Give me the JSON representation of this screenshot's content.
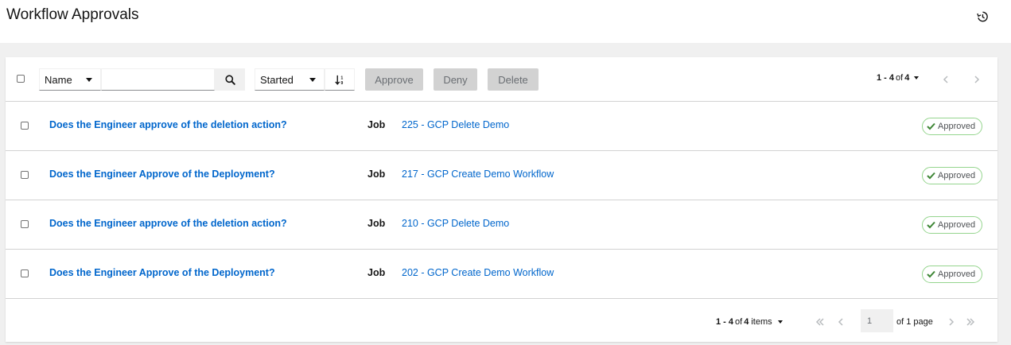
{
  "header": {
    "title": "Workflow Approvals",
    "history_icon": "history-icon"
  },
  "toolbar": {
    "filter_field": "Name",
    "search_value": "",
    "search_icon": "search-icon",
    "sort_field": "Started",
    "sort_icon": "sort-ascending-icon",
    "approve_label": "Approve",
    "deny_label": "Deny",
    "delete_label": "Delete",
    "pagination": {
      "range": "1 - 4",
      "of": "of",
      "total": "4"
    }
  },
  "rows": [
    {
      "title": "Does the Engineer approve of the deletion action?",
      "type": "Job",
      "job": "225 - GCP Delete Demo",
      "status": "Approved"
    },
    {
      "title": "Does the Engineer Approve of the Deployment?",
      "type": "Job",
      "job": "217 - GCP Create Demo Workflow",
      "status": "Approved"
    },
    {
      "title": "Does the Engineer approve of the deletion action?",
      "type": "Job",
      "job": "210 - GCP Delete Demo",
      "status": "Approved"
    },
    {
      "title": "Does the Engineer Approve of the Deployment?",
      "type": "Job",
      "job": "202 - GCP Create Demo Workflow",
      "status": "Approved"
    }
  ],
  "footer": {
    "range": "1 - 4",
    "of": "of",
    "total": "4",
    "items_label": "items",
    "page_value": "1",
    "of_pages": "of 1 page"
  },
  "colors": {
    "link": "#0066cc",
    "approved_border": "#95d58e",
    "approved_check": "#3e8635",
    "disabled_button": "#d2d2d2"
  }
}
